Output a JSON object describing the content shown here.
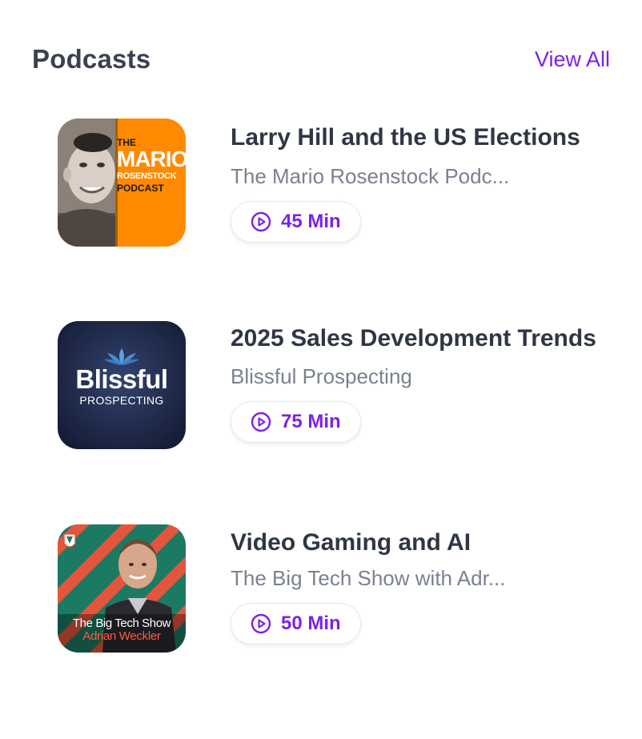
{
  "header": {
    "title": "Podcasts",
    "view_all_label": "View All"
  },
  "colors": {
    "accent": "#7c22e6",
    "title_text": "#2f3644",
    "muted_text": "#7a8190",
    "pill_border": "#e6e8ee"
  },
  "podcasts": [
    {
      "episode_title": "Larry Hill and the US Elections",
      "show_name": "The Mario Rosenstock Podc...",
      "duration": "45 Min",
      "cover": {
        "line1": "THE",
        "line2": "MARIO",
        "line3": "ROSENSTOCK",
        "line4": "PODCAST",
        "bg_color": "#ff8a00"
      }
    },
    {
      "episode_title": "2025 Sales Development Trends",
      "show_name": "Blissful Prospecting",
      "duration": "75 Min",
      "cover": {
        "line1": "Blissful",
        "line2": "PROSPECTING",
        "bg_color": "#1e2a4a"
      }
    },
    {
      "episode_title": "Video Gaming and AI",
      "show_name": "The Big Tech Show with Adr...",
      "duration": "50 Min",
      "cover": {
        "line1": "The Big Tech Show",
        "line2": "Adrian Weckler",
        "bg_color": "#1c7a63"
      }
    }
  ],
  "icons": {
    "duration": "play-circle-icon"
  }
}
